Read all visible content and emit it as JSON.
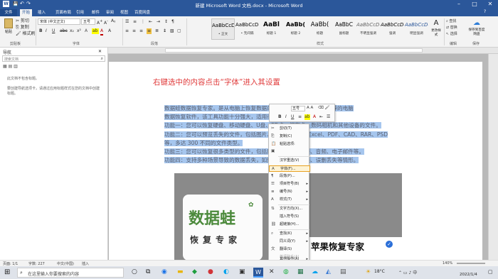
{
  "window": {
    "title": "新建 Microsoft Word 文档.docx - Microsoft Word"
  },
  "tabs": [
    "文件",
    "开始",
    "插入",
    "页面布局",
    "引用",
    "邮件",
    "审阅",
    "视图",
    "百度网盘"
  ],
  "ribbon": {
    "clipboard": {
      "paste": "粘贴",
      "cut": "剪切",
      "copy": "复制",
      "format_painter": "格式刷",
      "group": "剪贴板"
    },
    "font": {
      "name": "宋体 (中文正文)",
      "size": "五号",
      "group": "字体"
    },
    "paragraph": {
      "group": "段落"
    },
    "styles": [
      {
        "preview": "AaBbCcDd",
        "name": "• 正文"
      },
      {
        "preview": "AaBbCcDd",
        "name": "• 无间隔"
      },
      {
        "preview": "AaBl",
        "name": "标题 1"
      },
      {
        "preview": "AaBb(",
        "name": "标题 2"
      },
      {
        "preview": "AaBb(",
        "name": "标题"
      },
      {
        "preview": "AaBbC",
        "name": "副标题"
      },
      {
        "preview": "AaBbCcDd",
        "name": "不明显强调"
      },
      {
        "preview": "AaBbCcDd",
        "name": "强调"
      },
      {
        "preview": "AaBbCcDd",
        "name": "明显强调"
      }
    ],
    "styles_group": "样式",
    "change_styles": "更改样式",
    "edit": {
      "find": "查找",
      "replace": "替换",
      "select": "选择",
      "group": "编辑"
    },
    "save": {
      "label": "保存到百度网盘",
      "group": "保存"
    }
  },
  "nav": {
    "title": "导航",
    "search_placeholder": "搜索文档",
    "text1": "此文档不包含标题。",
    "text2": "要创建导航选项卡，请通过应用标题样式在您的文档中创建标题。"
  },
  "doc": {
    "heading": "右键选中的内容点击“字体”进入其设置",
    "lines": [
      "数据蛙数据恢复专家。是从电脑上恢复数据的好工具。作为一款值得推荐的电脑",
      "数据恢复软件，该工具功能十分强大，适用很多软件情况。",
      "功能一：您可以恢复硬盘、移动硬盘、U盘、SD卡、储存卡、数码相机和其他设备的文件。",
      "功能二：您可以预览丢失的文件，包括图片、文档、Word、Excel、PDF、CAD、RAR、PSD",
      "等，多达 300 不同的文件类型。",
      "功能三：您可以恢复很多类型的文件，包括照片、视频、文件、音频、电子邮件等。",
      "功能四：支持多种场景导致的数据丢失，如删除、格式化丢失、误删丢失等情形。"
    ],
    "image_big": "数据蛙",
    "image_sub": "恢复专家",
    "image_caption": "苹果恢复专家"
  },
  "mini_toolbar": {
    "font": "五号"
  },
  "context_menu": [
    {
      "label": "剪切(T)",
      "icon": "scissors-icon",
      "disabled": false
    },
    {
      "label": "复制(C)",
      "icon": "copy-icon",
      "disabled": false
    },
    {
      "label": "粘贴选项:",
      "icon": "paste-icon",
      "disabled": false
    },
    {
      "label": "",
      "icon": "paste-text-icon",
      "disabled": false
    },
    {
      "label": "汉字重选(V)",
      "icon": "",
      "disabled": false
    },
    {
      "label": "字体(F)...",
      "icon": "font-icon",
      "disabled": false,
      "highlight": true
    },
    {
      "label": "段落(P)...",
      "icon": "paragraph-icon",
      "disabled": false
    },
    {
      "label": "项目符号(B)",
      "icon": "bullets-icon",
      "disabled": false,
      "submenu": true
    },
    {
      "label": "编号(N)",
      "icon": "numbering-icon",
      "disabled": false,
      "submenu": true
    },
    {
      "label": "样式(T)",
      "icon": "styles-icon",
      "disabled": false,
      "submenu": true
    },
    {
      "label": "文字方向(X)...",
      "icon": "text-direction-icon",
      "disabled": false
    },
    {
      "label": "插入符号(S)",
      "icon": "",
      "disabled": false
    },
    {
      "label": "超链接(H)...",
      "icon": "hyperlink-icon",
      "disabled": false
    },
    {
      "label": "查找(K)",
      "icon": "find-icon",
      "disabled": false,
      "submenu": true
    },
    {
      "label": "同义词(Y)",
      "icon": "",
      "disabled": false,
      "submenu": true
    },
    {
      "label": "翻译(S)",
      "icon": "translate-icon",
      "disabled": false
    },
    {
      "label": "英语助手(A)",
      "icon": "",
      "disabled": true
    },
    {
      "label": "其他操作(A)",
      "icon": "",
      "disabled": false,
      "submenu": true
    }
  ],
  "status": {
    "page": "页面: 1/1",
    "words": "字数: 227",
    "lang": "中文(中国)",
    "mode": "插入",
    "zoom": "140%"
  },
  "taskbar": {
    "search_placeholder": "在这里输入你要搜索的内容",
    "weather": "18°C",
    "time": "2022/1/4"
  }
}
